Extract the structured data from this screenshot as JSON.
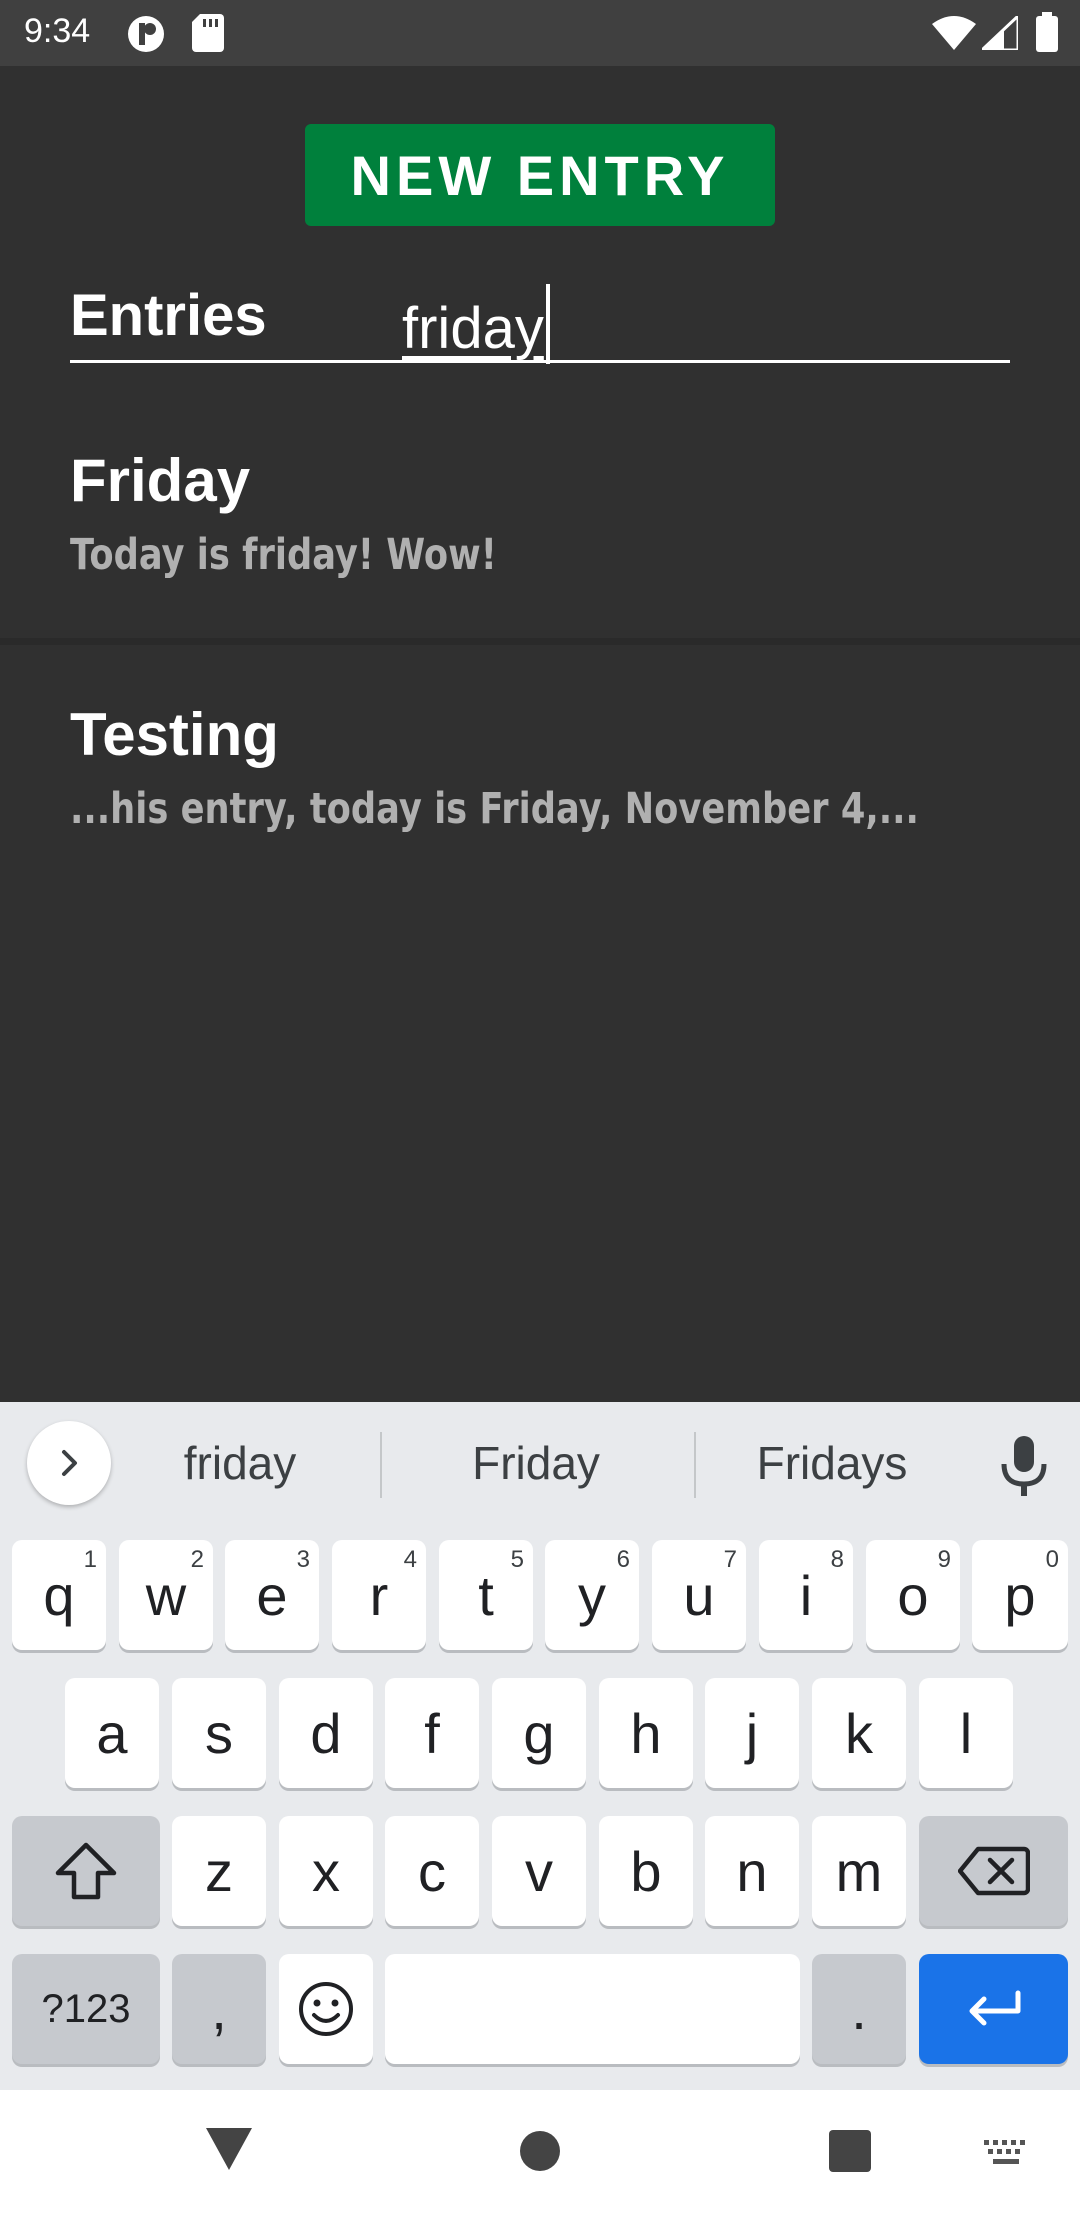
{
  "status_bar": {
    "time": "9:34",
    "left_icons": [
      "app-notification-icon",
      "sd-card-icon"
    ],
    "right_icons": [
      "wifi-icon",
      "cell-signal-icon",
      "battery-icon"
    ]
  },
  "app": {
    "new_entry_label": "NEW ENTRY",
    "entries_label": "Entries",
    "search_value": "friday",
    "entries": [
      {
        "title": "Friday",
        "snippet": "Today is friday! Wow!"
      },
      {
        "title": "Testing",
        "snippet": "...his entry, today is Friday, November 4,..."
      }
    ]
  },
  "keyboard": {
    "suggestions": [
      "friday",
      "Friday",
      "Fridays"
    ],
    "row1": [
      {
        "label": "q",
        "hint": "1"
      },
      {
        "label": "w",
        "hint": "2"
      },
      {
        "label": "e",
        "hint": "3"
      },
      {
        "label": "r",
        "hint": "4"
      },
      {
        "label": "t",
        "hint": "5"
      },
      {
        "label": "y",
        "hint": "6"
      },
      {
        "label": "u",
        "hint": "7"
      },
      {
        "label": "i",
        "hint": "8"
      },
      {
        "label": "o",
        "hint": "9"
      },
      {
        "label": "p",
        "hint": "0"
      }
    ],
    "row2": [
      "a",
      "s",
      "d",
      "f",
      "g",
      "h",
      "j",
      "k",
      "l"
    ],
    "row3": [
      "z",
      "x",
      "c",
      "v",
      "b",
      "n",
      "m"
    ],
    "symbols_label": "?123",
    "comma_label": ",",
    "period_label": ".",
    "enter_color": "#1a73e8"
  },
  "colors": {
    "background": "#303030",
    "accent_button": "#00803c",
    "snippet_text": "#b0b0b0"
  }
}
